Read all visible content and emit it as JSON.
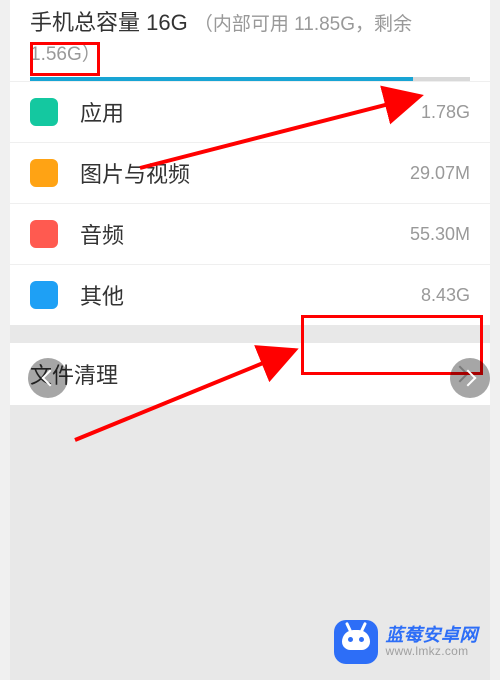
{
  "header": {
    "title_prefix": "手机总容量 16G",
    "title_suffix": "（内部可用 11.85G，剩余1.56G）",
    "progress_percent": 87
  },
  "categories": [
    {
      "swatch_class": "sw-green",
      "label": "应用",
      "value": "1.78G"
    },
    {
      "swatch_class": "sw-orange",
      "label": "图片与视频",
      "value": "29.07M"
    },
    {
      "swatch_class": "sw-red",
      "label": "音频",
      "value": "55.30M"
    },
    {
      "swatch_class": "sw-blue",
      "label": "其他",
      "value": "8.43G"
    }
  ],
  "cleanup": {
    "label": "文件清理"
  },
  "watermark": {
    "line1": "蓝莓安卓网",
    "line2": "www.lmkz.com"
  }
}
